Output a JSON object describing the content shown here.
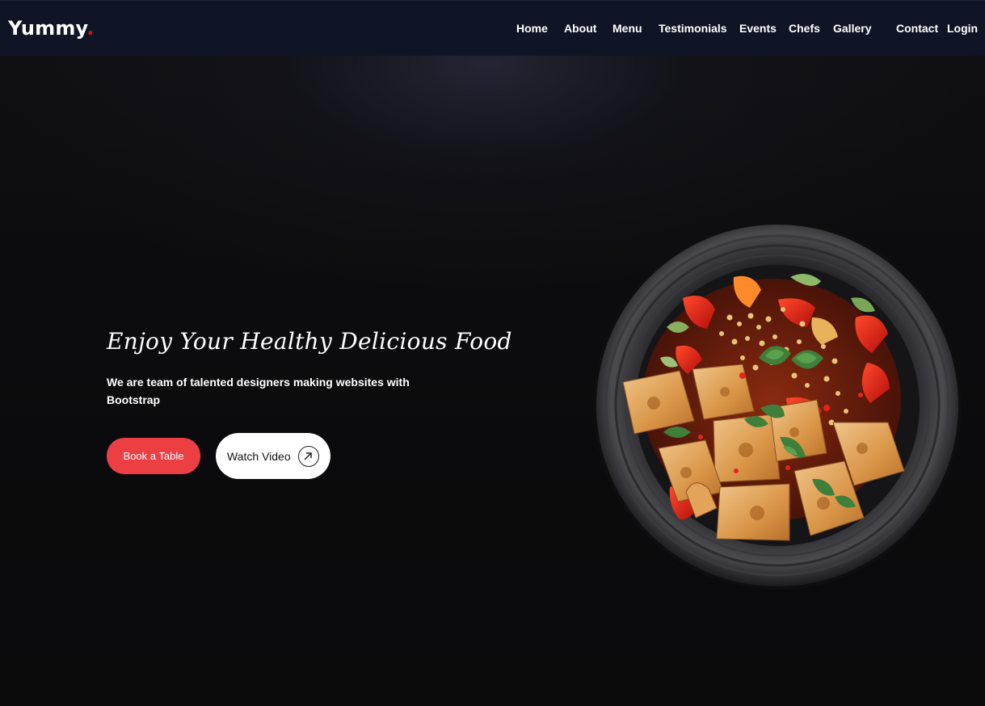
{
  "brand": {
    "name": "Yummy",
    "dot": ".",
    "dot_color": "#ce1212"
  },
  "nav": {
    "items": [
      {
        "label": "Home"
      },
      {
        "label": "About"
      },
      {
        "label": "Menu"
      },
      {
        "label": "Testimonials"
      },
      {
        "label": "Events"
      },
      {
        "label": "Chefs"
      },
      {
        "label": "Gallery"
      },
      {
        "label": "Contact"
      },
      {
        "label": "Login"
      }
    ]
  },
  "hero": {
    "title": "Enjoy Your Healthy Delicious Food",
    "subtitle": "We are team of talented designers making websites with Bootstrap",
    "book_label": "Book a Table",
    "watch_label": "Watch Video",
    "accent_color": "#ec3f44"
  },
  "icons": {
    "watch": "arrow-up-right-icon",
    "dish": "food-bowl-image"
  }
}
